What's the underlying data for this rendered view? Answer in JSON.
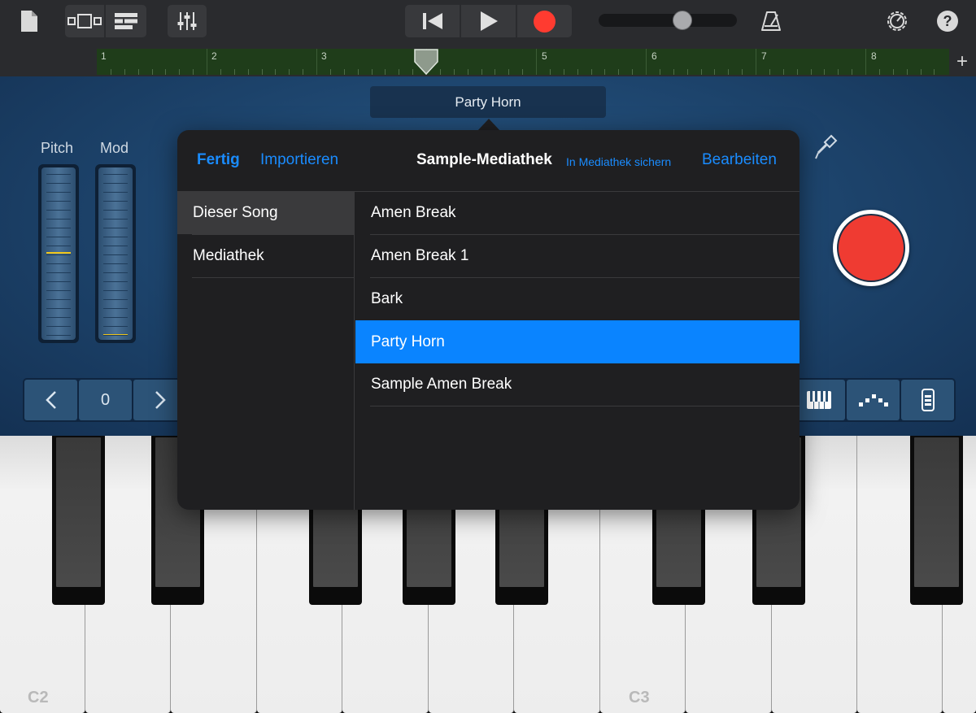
{
  "toolbar": {
    "icons": [
      "document-icon",
      "browser-view-icon",
      "tracks-view-icon",
      "mixer-icon",
      "rewind-icon",
      "play-icon",
      "record-icon",
      "metronome-icon",
      "settings-icon",
      "help-icon"
    ],
    "help_label": "?",
    "record_color": "#ff3b30"
  },
  "ruler": {
    "bars": [
      "1",
      "2",
      "3",
      "4",
      "5",
      "6",
      "7",
      "8"
    ],
    "add_label": "+"
  },
  "instrument": {
    "name": "Party Horn",
    "pitch_label": "Pitch",
    "mod_label": "Mod",
    "octave_value": "0"
  },
  "keyboard": {
    "labels": [
      "C2",
      "C3"
    ]
  },
  "popover": {
    "done_label": "Fertig",
    "import_label": "Importieren",
    "title": "Sample-Mediathek",
    "save_label": "In Mediathek sichern",
    "edit_label": "Bearbeiten",
    "sources": [
      "Dieser Song",
      "Mediathek"
    ],
    "selected_source": "Dieser Song",
    "samples": [
      "Amen Break",
      "Amen Break 1",
      "Bark",
      "Party Horn",
      "Sample Amen Break"
    ],
    "selected_sample": "Party Horn",
    "accent_color": "#0a84ff"
  }
}
